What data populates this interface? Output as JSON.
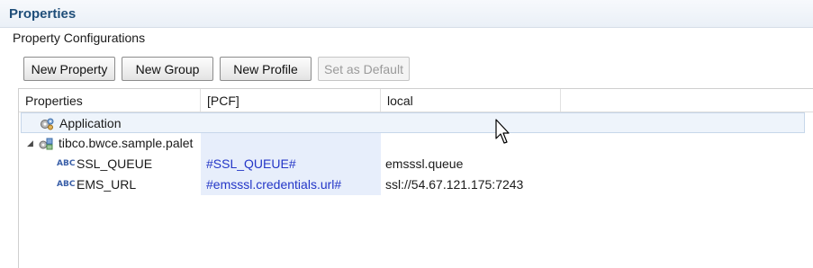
{
  "panel": {
    "title": "Properties",
    "section_label": "Property Configurations"
  },
  "toolbar": {
    "new_property": "New Property",
    "new_group": "New Group",
    "new_profile": "New Profile",
    "set_as_default": "Set as Default"
  },
  "table": {
    "columns": [
      "Properties",
      "[PCF]",
      "local"
    ],
    "rows": [
      {
        "name": "Application",
        "icon": "gears-icon",
        "pcf": "",
        "local": ""
      },
      {
        "name": "tibco.bwce.sample.palet",
        "icon": "module-icon",
        "expanded": true,
        "pcf": "",
        "local": ""
      },
      {
        "name": "SSL_QUEUE",
        "icon": "string-type-icon",
        "icon_text": "ABC",
        "pcf": "#SSL_QUEUE#",
        "local": "emsssl.queue"
      },
      {
        "name": "EMS_URL",
        "icon": "string-type-icon",
        "icon_text": "ABC",
        "pcf": "#emsssl.credentials.url#",
        "local": "ssl://54.67.121.175:7243"
      }
    ]
  },
  "colors": {
    "title": "#1f4e79",
    "pcf_text": "#2336c7",
    "pcf_bg": "#e7eefb",
    "selection": "#eef4fb"
  }
}
